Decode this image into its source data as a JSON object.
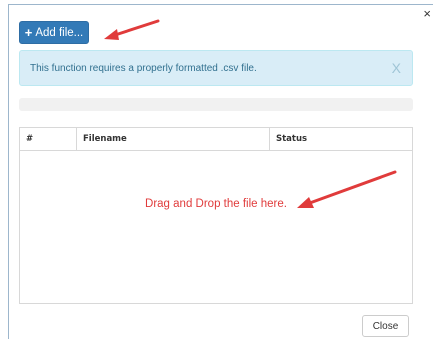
{
  "dialog": {
    "close_glyph": "×"
  },
  "toolbar": {
    "add_icon": "plus-icon",
    "add_label": "Add file..."
  },
  "alert": {
    "message": "This function requires a properly formatted .csv file.",
    "dismiss_label": "X"
  },
  "upload_progress": {
    "value": 0
  },
  "file_table": {
    "columns": [
      "#",
      "Filename",
      "Status"
    ],
    "rows": [],
    "drop_hint": "Drag and Drop the file here."
  },
  "footer": {
    "close_label": "Close"
  },
  "annotations": {
    "color": "#e03b3b"
  }
}
